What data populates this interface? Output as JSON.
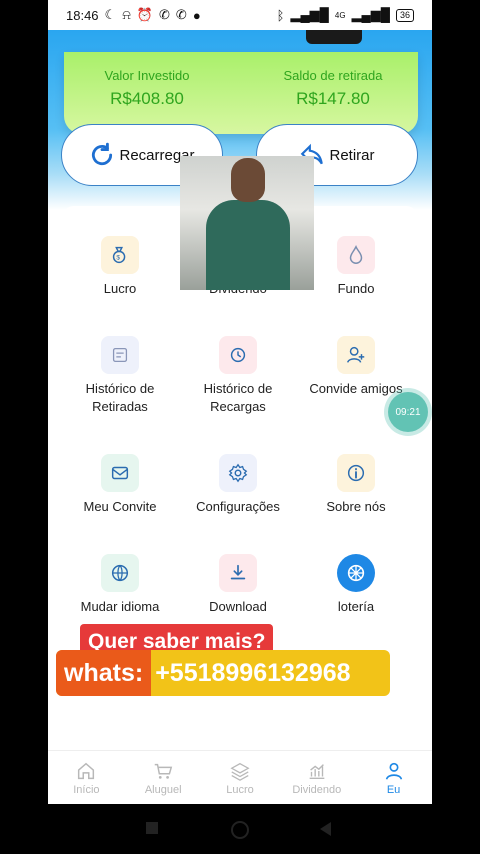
{
  "status_bar": {
    "time": "18:46",
    "battery": "36",
    "network": "4G"
  },
  "stats": {
    "invested_label": "Valor Investido",
    "invested_value": "R$408.80",
    "withdraw_label": "Saldo de retirada",
    "withdraw_value": "R$147.80"
  },
  "actions": {
    "recharge": "Recarregar",
    "withdraw": "Retirar"
  },
  "menu": [
    {
      "label": "Lucro",
      "icon": "money-bag-icon"
    },
    {
      "label": "Dividendo",
      "icon": "chart-icon"
    },
    {
      "label": "Fundo",
      "icon": "flame-icon"
    },
    {
      "label": "Histórico de Retiradas",
      "icon": "wallet-icon"
    },
    {
      "label": "Histórico de Recargas",
      "icon": "history-icon"
    },
    {
      "label": "Convide amigos",
      "icon": "add-user-icon"
    },
    {
      "label": "Meu Convite",
      "icon": "envelope-icon"
    },
    {
      "label": "Configurações",
      "icon": "gear-icon"
    },
    {
      "label": "Sobre nós",
      "icon": "info-icon"
    },
    {
      "label": "Mudar idioma",
      "icon": "globe-icon"
    },
    {
      "label": "Download",
      "icon": "download-icon"
    },
    {
      "label": "lotería",
      "icon": "wheel-icon"
    }
  ],
  "float_time": "09:21",
  "ad": {
    "question": "Quer saber mais?",
    "whats_label": "whats:",
    "phone": "+5518996132968"
  },
  "tabs": [
    {
      "label": "Início",
      "icon": "home-icon",
      "active": false
    },
    {
      "label": "Aluguel",
      "icon": "cart-icon",
      "active": false
    },
    {
      "label": "Lucro",
      "icon": "layers-icon",
      "active": false
    },
    {
      "label": "Dividendo",
      "icon": "bar-chart-icon",
      "active": false
    },
    {
      "label": "Eu",
      "icon": "user-icon",
      "active": true
    }
  ]
}
